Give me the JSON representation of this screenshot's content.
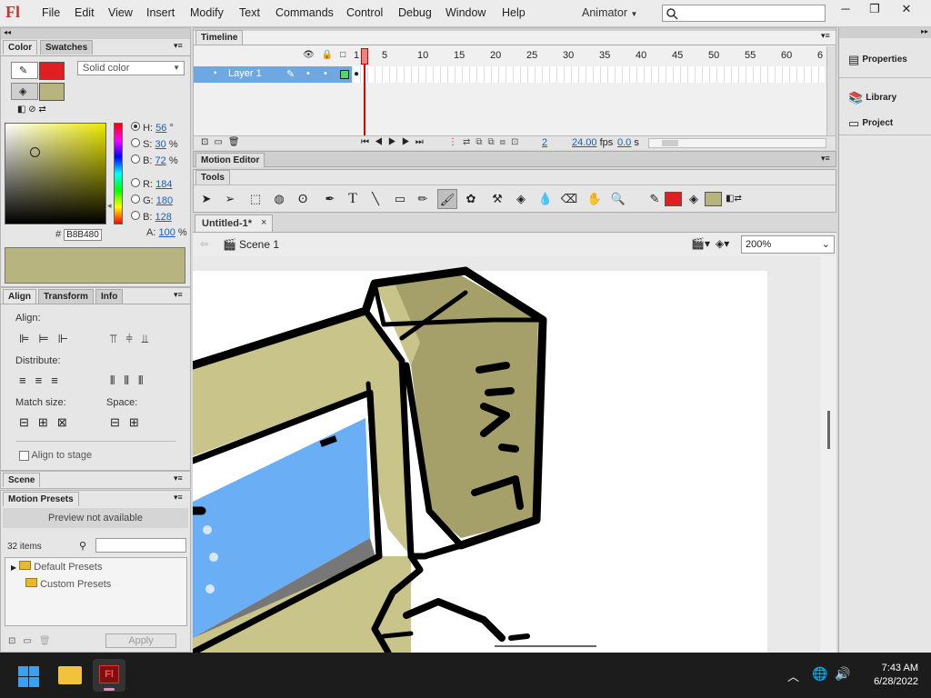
{
  "app": {
    "logo": "Fl"
  },
  "menu": [
    "File",
    "Edit",
    "View",
    "Insert",
    "Modify",
    "Text",
    "Commands",
    "Control",
    "Debug",
    "Window",
    "Help"
  ],
  "workspace": "Animator",
  "color_panel": {
    "tabs": [
      "Color",
      "Swatches"
    ],
    "fill_type": "Solid color",
    "stroke_color": "#e02020",
    "fill_color": "#b8b480",
    "hsb": {
      "h_label": "H:",
      "h": "56",
      "h_unit": "°",
      "s_label": "S:",
      "s": "30",
      "s_unit": "%",
      "b_label": "B:",
      "b": "72",
      "b_unit": "%"
    },
    "rgb": {
      "r_label": "R:",
      "r": "184",
      "g_label": "G:",
      "g": "180",
      "b_label": "B:",
      "b": "128"
    },
    "alpha_label": "A:",
    "alpha": "100",
    "alpha_unit": "%",
    "hex_prefix": "#",
    "hex": "B8B480"
  },
  "align_panel": {
    "tabs": [
      "Align",
      "Transform",
      "Info"
    ],
    "align_label": "Align:",
    "distribute_label": "Distribute:",
    "match_size_label": "Match size:",
    "space_label": "Space:",
    "align_to_stage": "Align to stage"
  },
  "scene_panel": {
    "title": "Scene"
  },
  "motion_presets": {
    "title": "Motion Presets",
    "preview": "Preview not available",
    "count": "32 items",
    "folders": [
      "Default Presets",
      "Custom Presets"
    ],
    "apply": "Apply"
  },
  "timeline": {
    "title": "Timeline",
    "layer": "Layer 1",
    "frame_numbers": [
      "1",
      "5",
      "10",
      "15",
      "20",
      "25",
      "30",
      "35",
      "40",
      "45",
      "50",
      "55",
      "60",
      "6"
    ],
    "current_frame": "2",
    "fps": "24.00",
    "fps_unit": "fps",
    "time": "0.0",
    "time_unit": "s"
  },
  "motion_editor": {
    "title": "Motion Editor"
  },
  "tools": {
    "title": "Tools",
    "stroke_color": "#e02020",
    "fill_color": "#b8b480"
  },
  "document": {
    "tab": "Untitled-1*",
    "close": "×",
    "scene": "Scene 1",
    "zoom": "200%"
  },
  "right_panel": {
    "items": [
      "Properties",
      "Library",
      "Project"
    ]
  },
  "taskbar": {
    "time": "7:43 AM",
    "date": "6/28/2022"
  }
}
